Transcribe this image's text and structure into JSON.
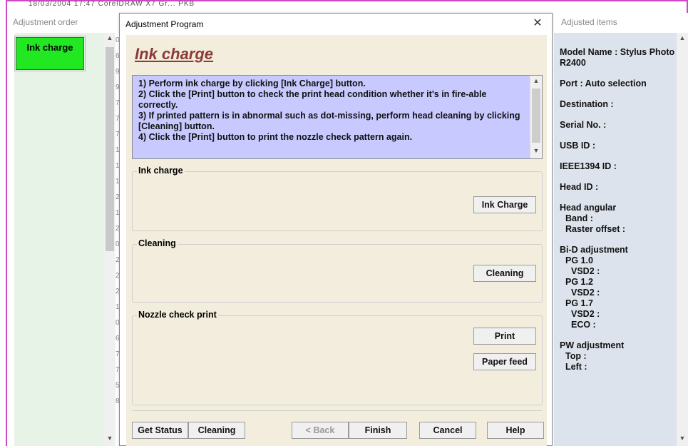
{
  "background": {
    "strip_text": "18/03/2004 17:47     CorelDRAW X7 Gr...            PKB"
  },
  "adjustment_order": {
    "title": "Adjustment order",
    "items": [
      {
        "label": "Ink charge",
        "color": "#22e822"
      }
    ]
  },
  "row_numbers": [
    "0",
    "6",
    "9",
    "9",
    "7",
    "7",
    "7",
    "1",
    "1",
    "1",
    "2",
    "1",
    "2",
    "0",
    "2",
    "2",
    "2",
    "1",
    "0",
    "6",
    "7",
    "7",
    "5",
    "8"
  ],
  "dialog": {
    "title": "Adjustment Program",
    "heading": "Ink charge",
    "instructions": "1) Perform ink charge by clicking [Ink Charge] button.\n2) Click the [Print] button to check the print head condition whether it's in fire-able correctly.\n3) If printed pattern is in abnormal such as dot-missing, perform head cleaning by clicking [Cleaning] button.\n4) Click the [Print] button to print the nozzle check pattern again.",
    "groups": {
      "ink_charge": {
        "label": "Ink charge",
        "button": "Ink Charge"
      },
      "cleaning": {
        "label": "Cleaning",
        "button": "Cleaning"
      },
      "nozzle": {
        "label": "Nozzle check print",
        "print_button": "Print",
        "paper_feed_button": "Paper feed"
      }
    },
    "footer": {
      "get_status": "Get Status",
      "cleaning": "Cleaning",
      "back": "< Back",
      "finish": "Finish",
      "cancel": "Cancel",
      "help": "Help"
    }
  },
  "adjusted_items": {
    "title": "Adjusted items",
    "model_name": "Model Name : Stylus Photo R2400",
    "port": "Port : Auto selection",
    "destination": "Destination :",
    "serial": "Serial No. :",
    "usb_id": "USB ID :",
    "ieee_id": "IEEE1394 ID :",
    "head_id": "Head ID :",
    "head_angular": "Head angular",
    "band": "Band :",
    "raster_offset": "Raster offset :",
    "bid_adjustment": "Bi-D adjustment",
    "pg10": "PG 1.0",
    "vsd2_1": "VSD2 :",
    "pg12": "PG 1.2",
    "vsd2_2": "VSD2 :",
    "pg17": "PG 1.7",
    "vsd2_3": "VSD2 :",
    "eco": "ECO :",
    "pw_adjustment": "PW adjustment",
    "top": "Top :",
    "left": "Left :"
  },
  "colors": {
    "heading": "#8b3a3a",
    "instructions_bg": "#c8caff",
    "dialog_bg": "#f2eddc",
    "frame": "#d048c8"
  }
}
